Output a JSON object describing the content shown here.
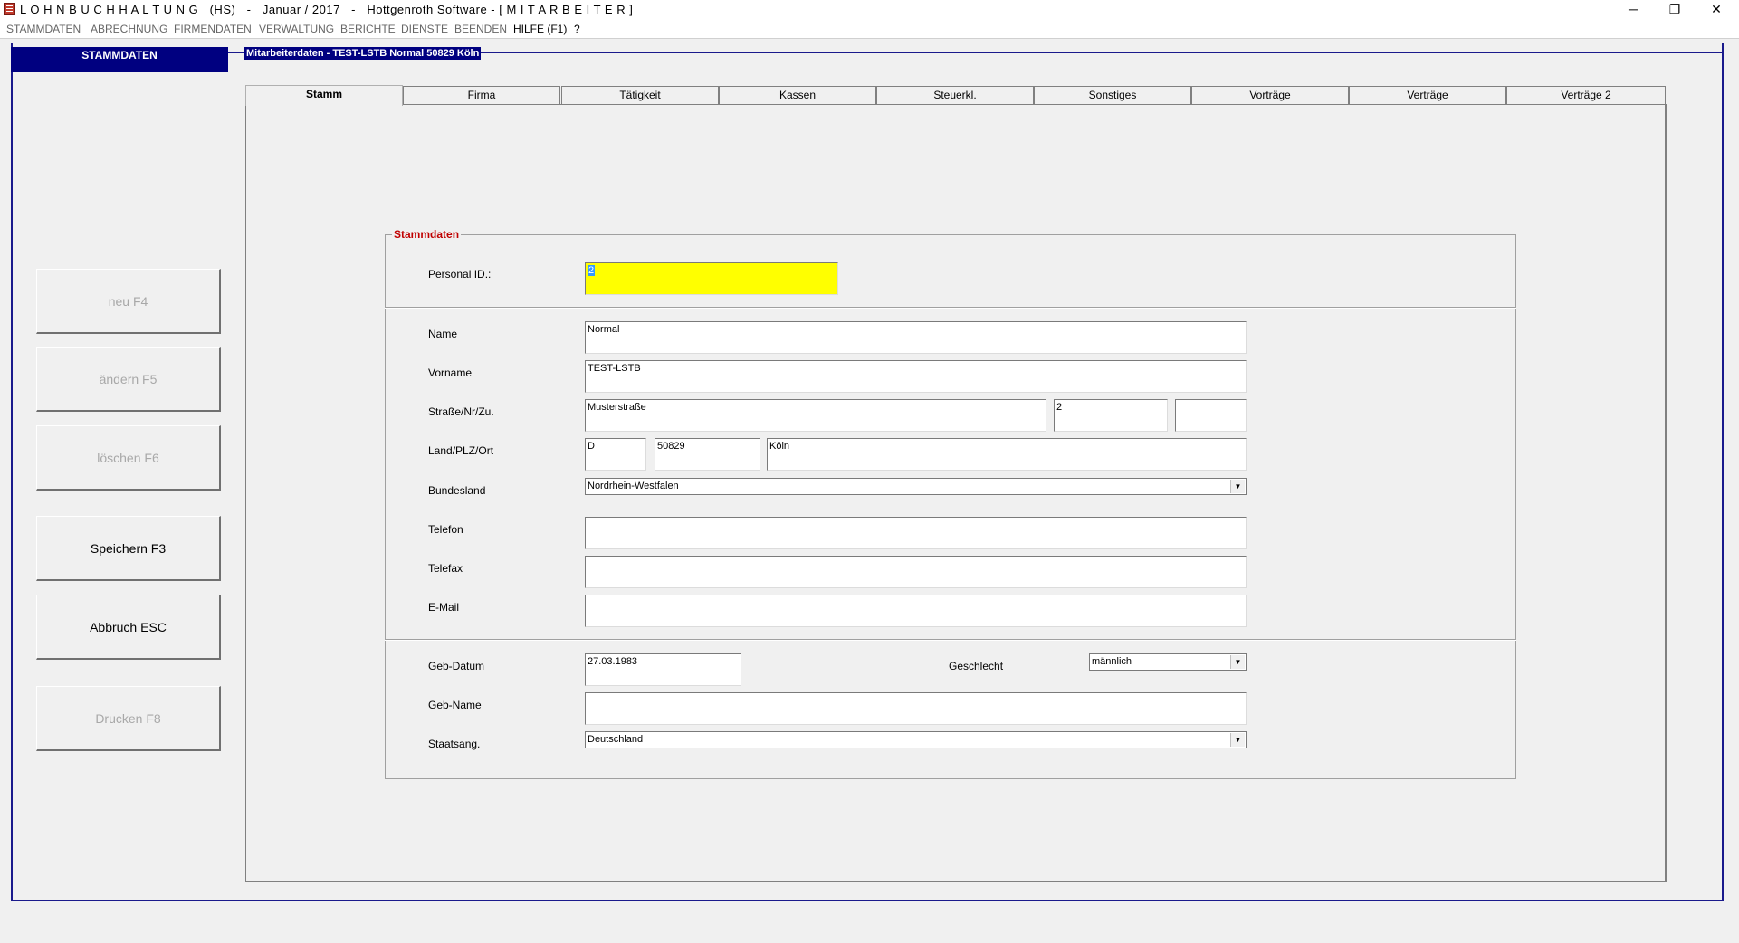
{
  "window": {
    "title": "L O H N B U C H H A L T U N G   (HS)   -   Januar / 2017   -   Hottgenroth Software - [ M I T A R B E I T E R ]",
    "minimize": "─",
    "restore": "❐",
    "close": "✕"
  },
  "menu": [
    "STAMMDATEN",
    "ABRECHNUNG",
    "FIRMENDATEN",
    "VERWALTUNG",
    "BERICHTE",
    "DIENSTE",
    "BEENDEN",
    "HILFE (F1)",
    "?"
  ],
  "module_title": "STAMMDATEN",
  "record_caption": "Mitarbeiterdaten - TEST-LSTB Normal   50829 Köln",
  "side_buttons": {
    "neu": "neu     F4",
    "aendern": "ändern     F5",
    "loeschen": "löschen     F6",
    "speichern": "Speichern    F3",
    "abbruch": "Abbruch ESC",
    "drucken": "Drucken   F8"
  },
  "tabs": [
    "Stamm",
    "Firma",
    "Tätigkeit",
    "Kassen",
    "Steuerkl.",
    "Sonstiges",
    "Vorträge",
    "Verträge",
    "Verträge 2"
  ],
  "group_title": "Stammdaten",
  "labels": {
    "personal_id": "Personal ID.:",
    "name": "Name",
    "vorname": "Vorname",
    "strasse": "Straße/Nr/Zu.",
    "land": "Land/PLZ/Ort",
    "bundesland": "Bundesland",
    "telefon": "Telefon",
    "telefax": "Telefax",
    "email": "E-Mail",
    "geb_datum": "Geb-Datum",
    "geschlecht": "Geschlecht",
    "geb_name": "Geb-Name",
    "staatsang": "Staatsang."
  },
  "values": {
    "personal_id": "2",
    "name": "Normal",
    "vorname": "TEST-LSTB",
    "strasse": "Musterstraße",
    "hausnr": "2",
    "zusatz": "",
    "land": "D",
    "plz": "50829",
    "ort": "Köln",
    "bundesland": "Nordrhein-Westfalen",
    "telefon": "",
    "telefax": "",
    "email": "",
    "geb_datum": "27.03.1983",
    "geschlecht": "männlich",
    "geb_name": "",
    "staatsang": "Deutschland"
  }
}
